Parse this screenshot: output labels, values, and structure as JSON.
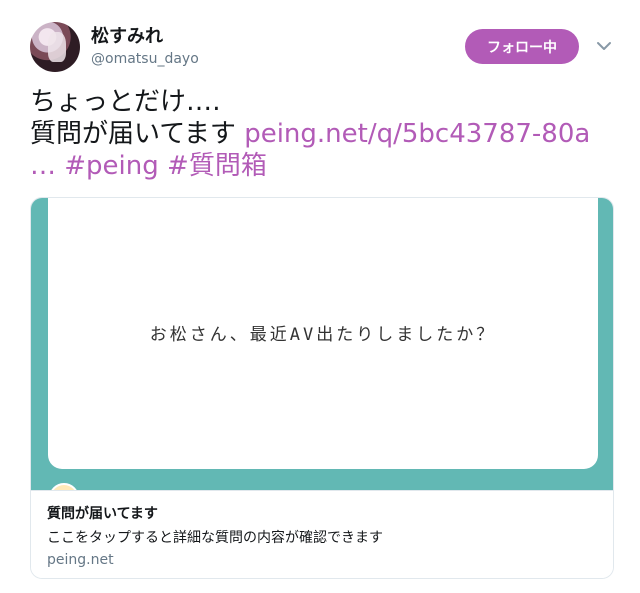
{
  "user": {
    "display_name": "松すみれ",
    "handle": "@omatsu_dayo"
  },
  "follow_button": {
    "label": "フォロー中"
  },
  "tweet": {
    "line1": "ちょっとだけ‥‥",
    "line2_text": "質問が届いてます ",
    "link_url": "peing.net/q/5bc43787-80a",
    "link_ellipsis": "…",
    "hashtag1": "#peing",
    "hashtag2": "#質問箱"
  },
  "card": {
    "image_question": "お松さん、最近AV出たりしましたか？",
    "title": "質問が届いてます",
    "description": "ここをタップすると詳細な質問の内容が確認できます",
    "domain": "peing.net"
  },
  "colors": {
    "accent": "#b25bb7",
    "card_teal": "#62b8b4",
    "muted": "#657786"
  }
}
